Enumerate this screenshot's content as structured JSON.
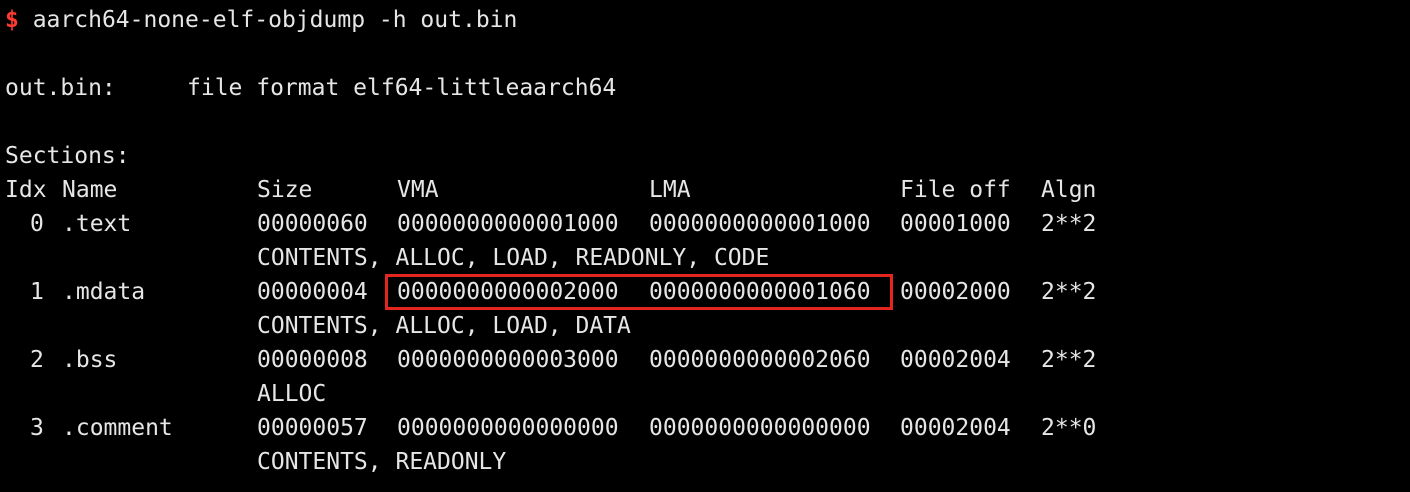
{
  "command": {
    "prompt_symbol": "$",
    "text": " aarch64-none-elf-objdump -h out.bin"
  },
  "file_line": {
    "name": "out.bin:",
    "format": "file format elf64-littleaarch64"
  },
  "sections_label": "Sections:",
  "headers": {
    "idx": "Idx",
    "name": "Name",
    "size": "Size",
    "vma": "VMA",
    "lma": "LMA",
    "file_off": "File off",
    "algn": "Algn"
  },
  "sections": [
    {
      "idx": "0",
      "name": ".text",
      "size": "00000060",
      "vma": "0000000000001000",
      "lma": "0000000000001000",
      "file_off": "00001000",
      "algn": "2**2",
      "flags": "CONTENTS, ALLOC, LOAD, READONLY, CODE"
    },
    {
      "idx": "1",
      "name": ".mdata",
      "size": "00000004",
      "vma": "0000000000002000",
      "lma": "0000000000001060",
      "file_off": "00002000",
      "algn": "2**2",
      "flags": "CONTENTS, ALLOC, LOAD, DATA"
    },
    {
      "idx": "2",
      "name": ".bss",
      "size": "00000008",
      "vma": "0000000000003000",
      "lma": "0000000000002060",
      "file_off": "00002004",
      "algn": "2**2",
      "flags": "ALLOC"
    },
    {
      "idx": "3",
      "name": ".comment",
      "size": "00000057",
      "vma": "0000000000000000",
      "lma": "0000000000000000",
      "file_off": "00002004",
      "algn": "2**0",
      "flags": "CONTENTS, READONLY"
    }
  ],
  "colors": {
    "background": "#000000",
    "text": "#e6e6e6",
    "prompt": "#ff3b30",
    "highlight_box": "#e5261f"
  }
}
